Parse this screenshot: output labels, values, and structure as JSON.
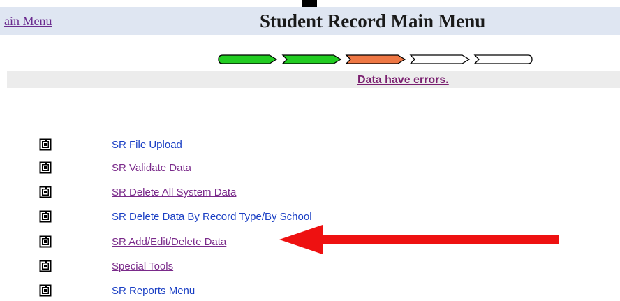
{
  "header": {
    "main_menu_link": "ain Menu",
    "title": "Student Record Main Menu"
  },
  "progress": {
    "steps": [
      {
        "state": "complete",
        "color": "#22cc22"
      },
      {
        "state": "complete",
        "color": "#22cc22"
      },
      {
        "state": "error",
        "color": "#ee7744"
      },
      {
        "state": "pending",
        "color": "#ffffff"
      },
      {
        "state": "pending",
        "color": "#ffffff"
      }
    ]
  },
  "status": {
    "message": "Data have errors.",
    "color": "#7a1f6f"
  },
  "menu": {
    "icon": "spiral-square-icon",
    "items": [
      {
        "label": "SR File Upload",
        "color": "#1a3fc4"
      },
      {
        "label": "SR Validate Data",
        "color": "#7a2a8a"
      },
      {
        "label": "SR Delete All System Data",
        "color": "#7a2a8a"
      },
      {
        "label": "SR Delete Data By Record Type/By School",
        "color": "#1a3fc4"
      },
      {
        "label": "SR Add/Edit/Delete Data",
        "color": "#7a2a8a"
      },
      {
        "label": "Special Tools",
        "color": "#7a2a8a"
      },
      {
        "label": "SR Reports Menu",
        "color": "#1a3fc4"
      }
    ]
  },
  "annotation": {
    "icon": "red-arrow-icon",
    "color": "#ee1111",
    "points_to": "SR Add/Edit/Delete Data"
  }
}
